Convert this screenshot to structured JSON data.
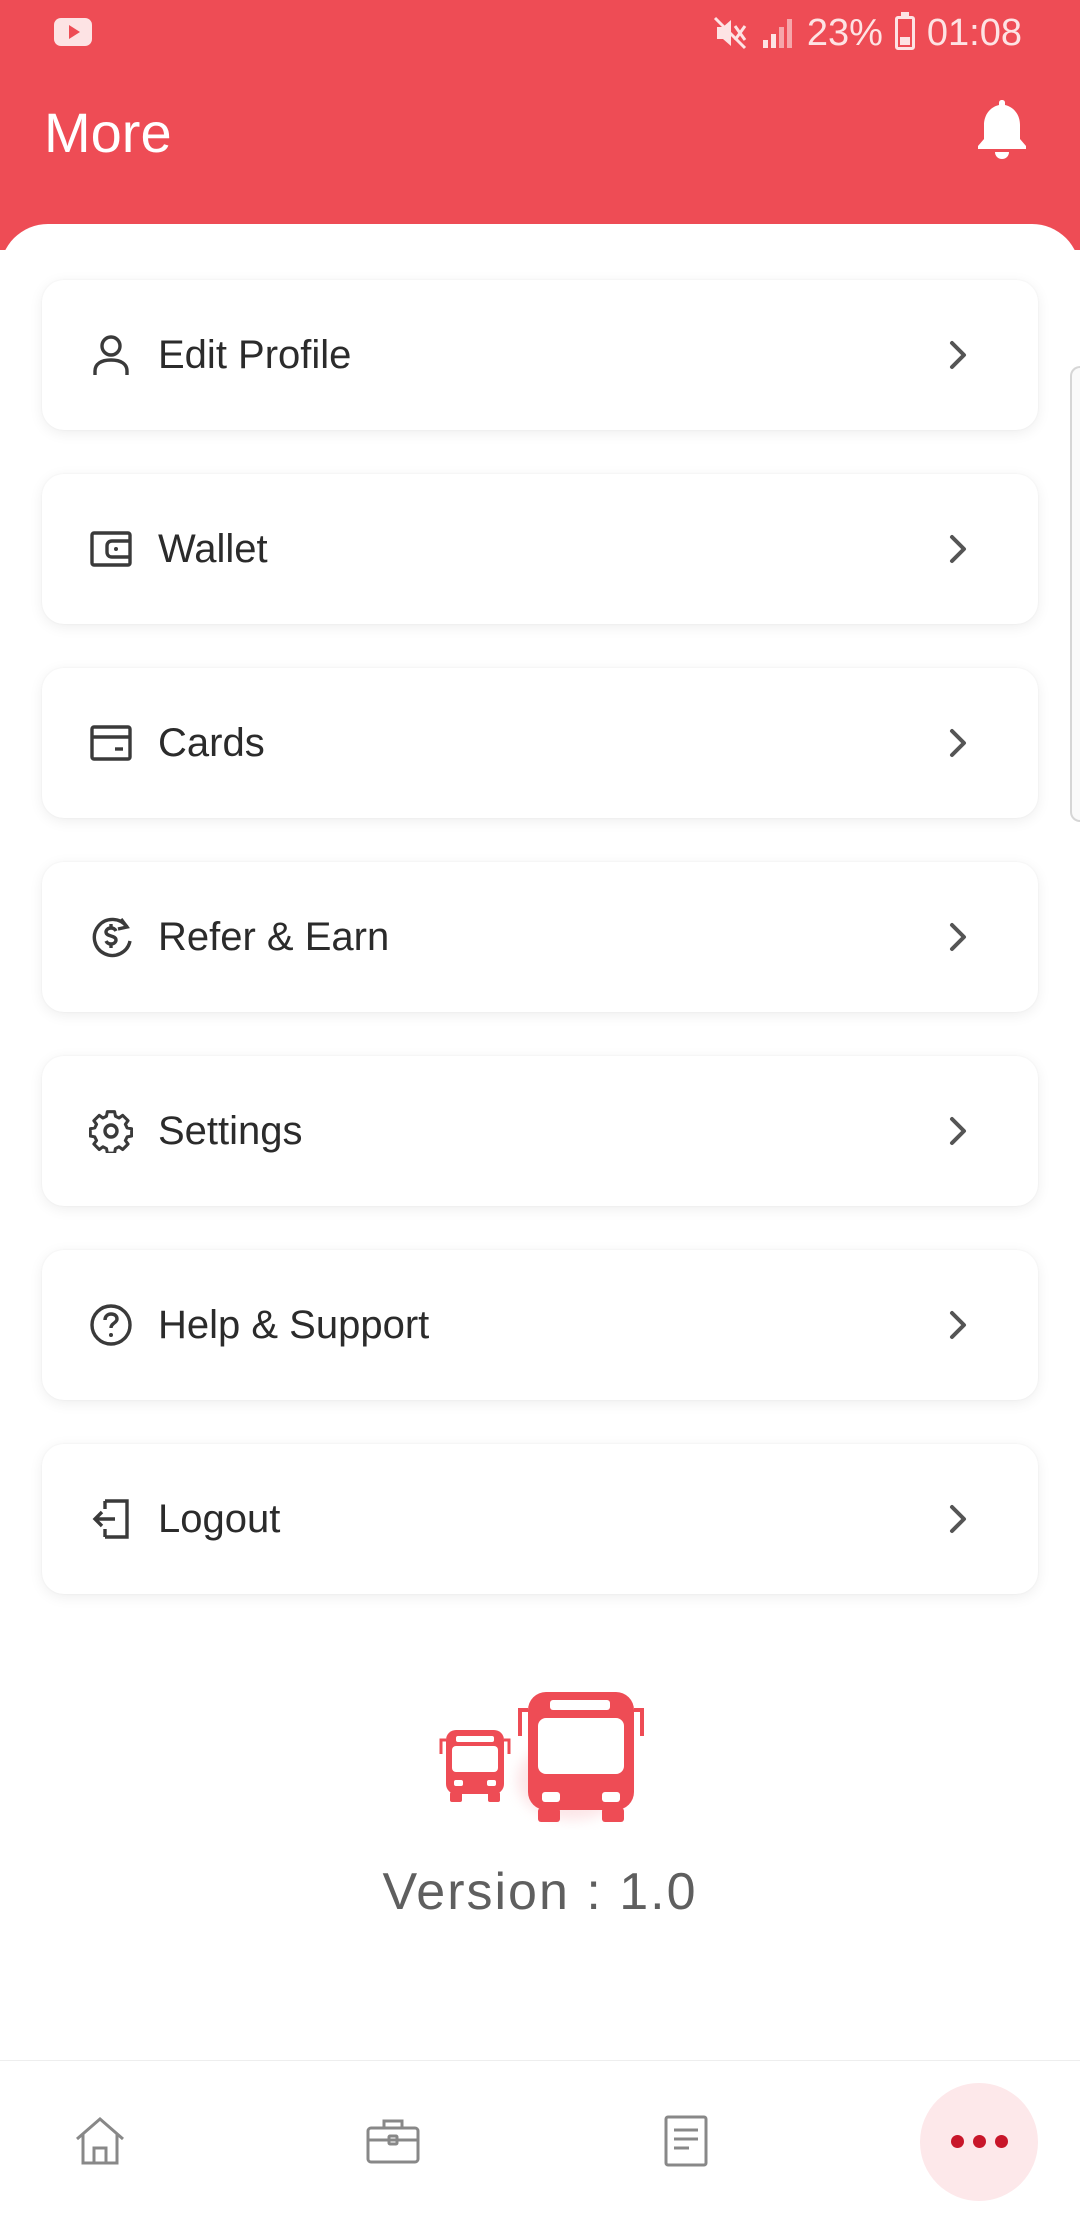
{
  "status_bar": {
    "battery": "23%",
    "time": "01:08"
  },
  "header": {
    "title": "More"
  },
  "menu": {
    "items": [
      {
        "label": "Edit Profile",
        "icon": "user-icon"
      },
      {
        "label": "Wallet",
        "icon": "wallet-icon"
      },
      {
        "label": "Cards",
        "icon": "card-icon"
      },
      {
        "label": "Refer & Earn",
        "icon": "refer-earn-icon"
      },
      {
        "label": "Settings",
        "icon": "gear-icon"
      },
      {
        "label": "Help & Support",
        "icon": "help-icon"
      },
      {
        "label": "Logout",
        "icon": "logout-icon"
      }
    ]
  },
  "footer": {
    "version": "Version : 1.0"
  },
  "bottom_nav": {
    "items": [
      "home-icon",
      "briefcase-icon",
      "document-icon",
      "more-icon"
    ],
    "active": "more-icon"
  },
  "colors": {
    "brand": "#ee4c55",
    "active_nav_bg": "#fde8ea",
    "active_nav_dots": "#c8162a"
  }
}
